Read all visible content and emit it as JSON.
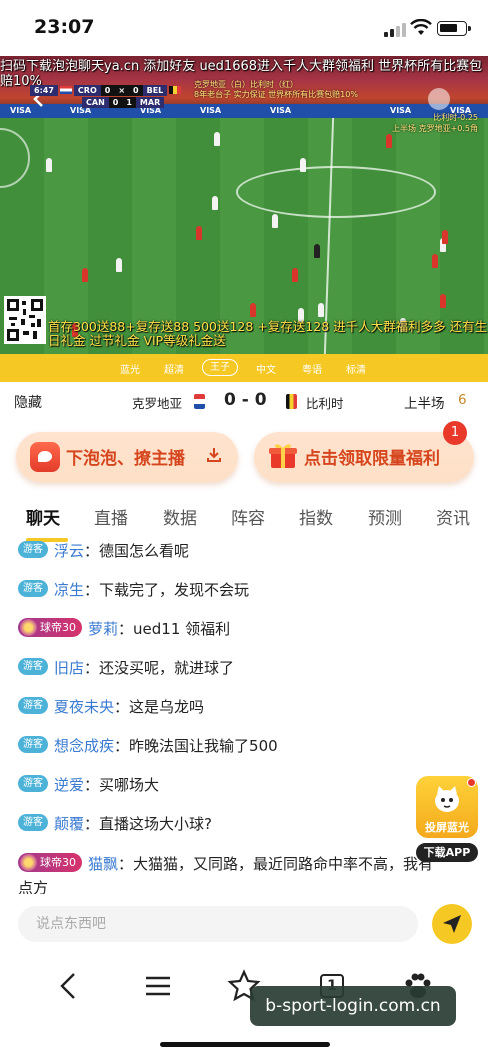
{
  "status_bar": {
    "time": "23:07"
  },
  "video": {
    "top_marquee": "扫码下载泡泡聊天ya.cn 添加好友 ued1668进入千人大群领福利 世界杯所有比赛包赔10%",
    "score_rows": [
      {
        "clock": "6:47",
        "home": "CRO",
        "home_score": "0",
        "away_score": "0",
        "away": "BEL"
      },
      {
        "home": "CAN",
        "home_score": "0",
        "away_score": "1",
        "away": "MAR"
      }
    ],
    "bug_promo": [
      "克罗地亚（白）比利时（红）",
      "8年老台子 实力保证 世界杯所有比赛包赔10%"
    ],
    "bug_right": [
      "比利时-0.25",
      "上半场 克罗地亚+0.5角"
    ],
    "bottom_marquee": "首存300送88+复存送88 500送128 +复存送128 进千人大群福利多多 还有生日礼金 过节礼金 VIP等级礼金送",
    "ad_text": [
      "VISA",
      "VISA",
      "VISA",
      "VISA",
      "VISA",
      "VISA",
      "VISA"
    ]
  },
  "stream_options": [
    "蓝光",
    "超清",
    "王子",
    "中文",
    "粤语",
    "标清"
  ],
  "stream_active_index": 2,
  "match": {
    "hide_label": "隐藏",
    "home_team": "克罗地亚",
    "score": "0 - 0",
    "away_team": "比利时",
    "period": "上半场",
    "minute": "6"
  },
  "promos": {
    "left_label": "下泡泡、撩主播",
    "right_label": "点击领取限量福利",
    "badge_count": "1"
  },
  "tabs": [
    "聊天",
    "直播",
    "数据",
    "阵容",
    "指数",
    "预测",
    "资讯"
  ],
  "chat": [
    {
      "badge": "游客",
      "user": "浮云",
      "text": "德国怎么看呢"
    },
    {
      "badge": "游客",
      "user": "凉生",
      "text": "下载完了，发现不会玩"
    },
    {
      "badge": "球帝30",
      "vip": true,
      "user": "萝莉",
      "text": "ued11 领福利"
    },
    {
      "badge": "游客",
      "user": "旧店",
      "text": "还没买呢，就进球了"
    },
    {
      "badge": "游客",
      "user": "夏夜未央",
      "text": "这是乌龙吗"
    },
    {
      "badge": "游客",
      "user": "想念成疾",
      "text": "昨晚法国让我输了500"
    },
    {
      "badge": "游客",
      "user": "逆爱",
      "text": "买哪场大"
    },
    {
      "badge": "游客",
      "user": "颠覆",
      "text": "直播这场大小球?"
    },
    {
      "badge": "球帝30",
      "vip": true,
      "user": "猫飘",
      "text": "大猫猫，又同路，最近同路命中率不高，我有点方"
    }
  ],
  "float_app": {
    "caption": "投屏蓝光",
    "download": "下载APP"
  },
  "input": {
    "placeholder": "说点东西吧"
  },
  "browser": {
    "tab_count": "1"
  },
  "watermark": "b-sport-login.com.cn",
  "colors": {
    "accent": "#f6c823",
    "promo_text": "#d6461e",
    "guest_badge": "#4cb2d8",
    "username": "#3a7ad1"
  }
}
